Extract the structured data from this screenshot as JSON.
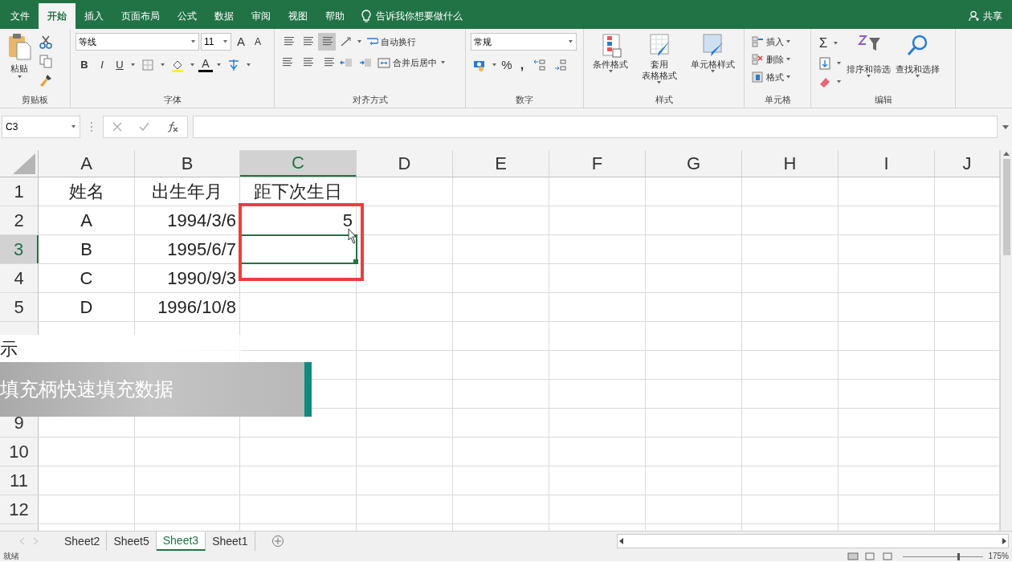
{
  "menu_tabs": [
    {
      "label": "文件",
      "selected": false
    },
    {
      "label": "开始",
      "selected": true
    },
    {
      "label": "插入",
      "selected": false
    },
    {
      "label": "页面布局",
      "selected": false
    },
    {
      "label": "公式",
      "selected": false
    },
    {
      "label": "数据",
      "selected": false
    },
    {
      "label": "审阅",
      "selected": false
    },
    {
      "label": "视图",
      "selected": false
    },
    {
      "label": "帮助",
      "selected": false
    }
  ],
  "tell_me": {
    "placeholder": "告诉我你想要做什么"
  },
  "share": "共享",
  "ribbon": {
    "groups": [
      {
        "kind": "clipboard",
        "label": "剪贴板",
        "paste": "粘贴"
      },
      {
        "kind": "font",
        "label": "字体",
        "font": "等线",
        "size": "11",
        "grow": "A",
        "shrink": "A",
        "bold": "B",
        "italic": "I",
        "underline": "U",
        "font_color": "A"
      },
      {
        "kind": "align",
        "label": "对齐方式",
        "wrap": "自动换行",
        "merge": "合并后居中"
      },
      {
        "kind": "number",
        "label": "数字",
        "format": "常规",
        "percent": "%",
        "comma": ","
      },
      {
        "kind": "styles",
        "label": "样式",
        "buttons": [
          {
            "lines": [
              "条件格式"
            ]
          },
          {
            "lines": [
              "套用",
              "表格格式"
            ]
          },
          {
            "lines": [
              "单元格样式"
            ]
          }
        ]
      },
      {
        "kind": "cells",
        "label": "单元格",
        "items": [
          "插入",
          "删除",
          "格式"
        ]
      },
      {
        "kind": "editing",
        "label": "编辑",
        "autosum": "Σ",
        "buttons": [
          "排序和筛选",
          "查找和选择"
        ]
      }
    ]
  },
  "formula_bar": {
    "name_box": "C3"
  },
  "columns": [
    {
      "label": "A",
      "selected": false
    },
    {
      "label": "B",
      "selected": false
    },
    {
      "label": "C",
      "selected": true
    },
    {
      "label": "D",
      "selected": false
    },
    {
      "label": "E",
      "selected": false
    },
    {
      "label": "F",
      "selected": false
    },
    {
      "label": "G",
      "selected": false
    },
    {
      "label": "H",
      "selected": false
    },
    {
      "label": "I",
      "selected": false
    },
    {
      "label": "J",
      "selected": false
    }
  ],
  "rows": [
    {
      "header": "1",
      "selected": false,
      "cells": [
        "姓名",
        "出生年月",
        "距下次生日"
      ]
    },
    {
      "header": "2",
      "selected": false,
      "cells": [
        "A",
        "1994/3/6",
        "5"
      ]
    },
    {
      "header": "3",
      "selected": true,
      "cells": [
        "B",
        "1995/6/7",
        ""
      ]
    },
    {
      "header": "4",
      "selected": false,
      "cells": [
        "C",
        "1990/9/3",
        ""
      ]
    },
    {
      "header": "5",
      "selected": false,
      "cells": [
        "D",
        "1996/10/8",
        ""
      ]
    },
    {
      "selected": false,
      "cells": []
    },
    {},
    {},
    {
      "header": "9",
      "selected": false,
      "cells": []
    },
    {
      "header": "10",
      "selected": false,
      "cells": []
    },
    {
      "header": "11",
      "selected": false,
      "cells": []
    },
    {
      "header": "12",
      "selected": false,
      "cells": []
    }
  ],
  "caption": {
    "top": "示",
    "main": "填充柄快速填充数据"
  },
  "sheet_tabs": [
    {
      "label": "Sheet2",
      "selected": false
    },
    {
      "label": "Sheet5",
      "selected": false
    },
    {
      "label": "Sheet3",
      "selected": true
    },
    {
      "label": "Sheet1",
      "selected": false
    }
  ],
  "status_bar": {
    "status": "就绪",
    "zoom_slider": {
      "level": 0.7
    },
    "zoom": "175%"
  }
}
